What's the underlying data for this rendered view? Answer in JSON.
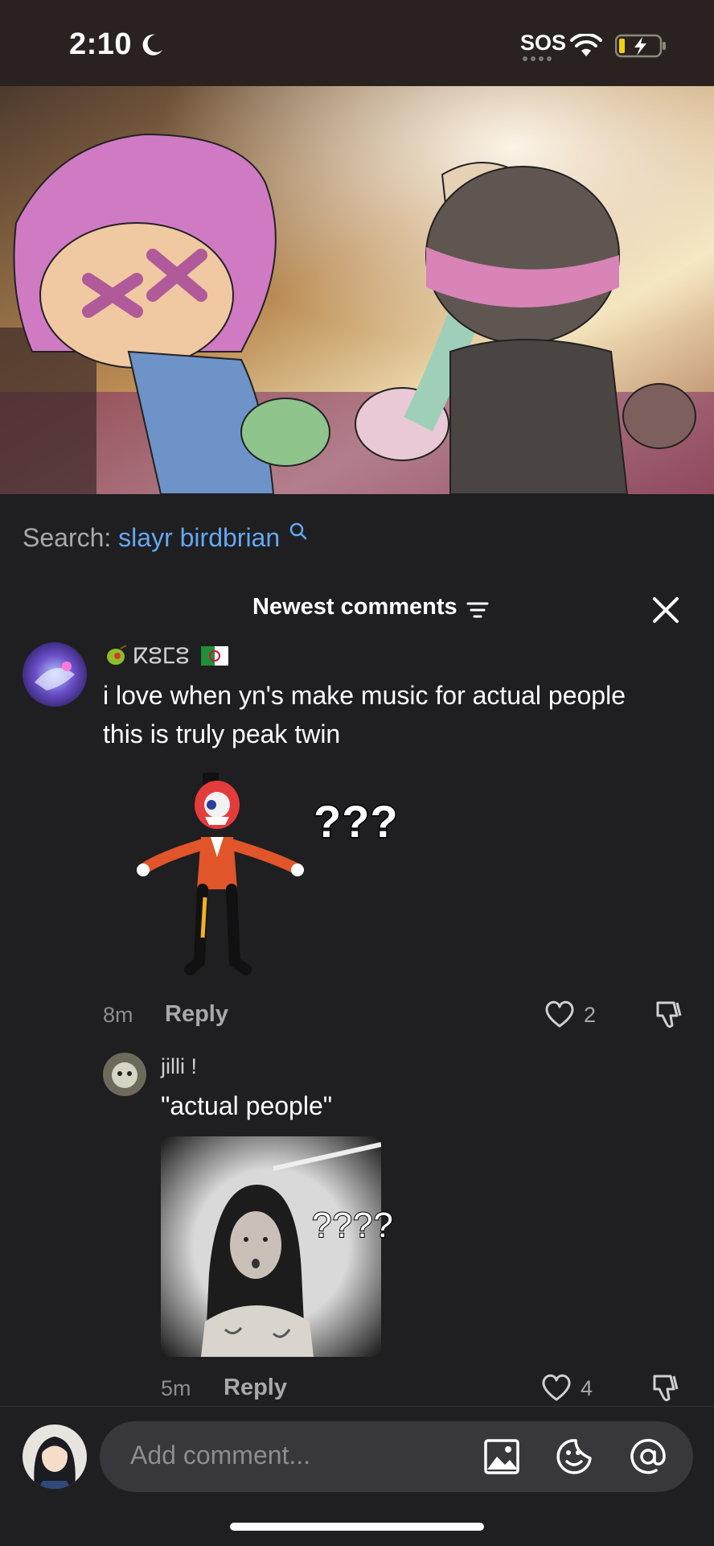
{
  "status": {
    "time": "2:10",
    "sos": "SOS"
  },
  "search": {
    "label": "Search:",
    "term": "slayr birdbrian"
  },
  "header": {
    "title": "Newest comments"
  },
  "comments": [
    {
      "username": "ⴽⵓⵎⵓ",
      "text_line1": "i love when yn's make music for actual people",
      "text_line2": "this is truly peak twin",
      "sticker_text": "???",
      "time": "8m",
      "reply": "Reply",
      "likes": "2"
    },
    {
      "username": "jilli !",
      "text": "\"actual people\"",
      "sticker_text": "????",
      "time": "5m",
      "reply": "Reply",
      "likes": "4"
    }
  ],
  "composer": {
    "placeholder": "Add comment..."
  },
  "colors": {
    "accent": "#63a8f0",
    "background": "#1f1e21",
    "input": "#38373b"
  }
}
